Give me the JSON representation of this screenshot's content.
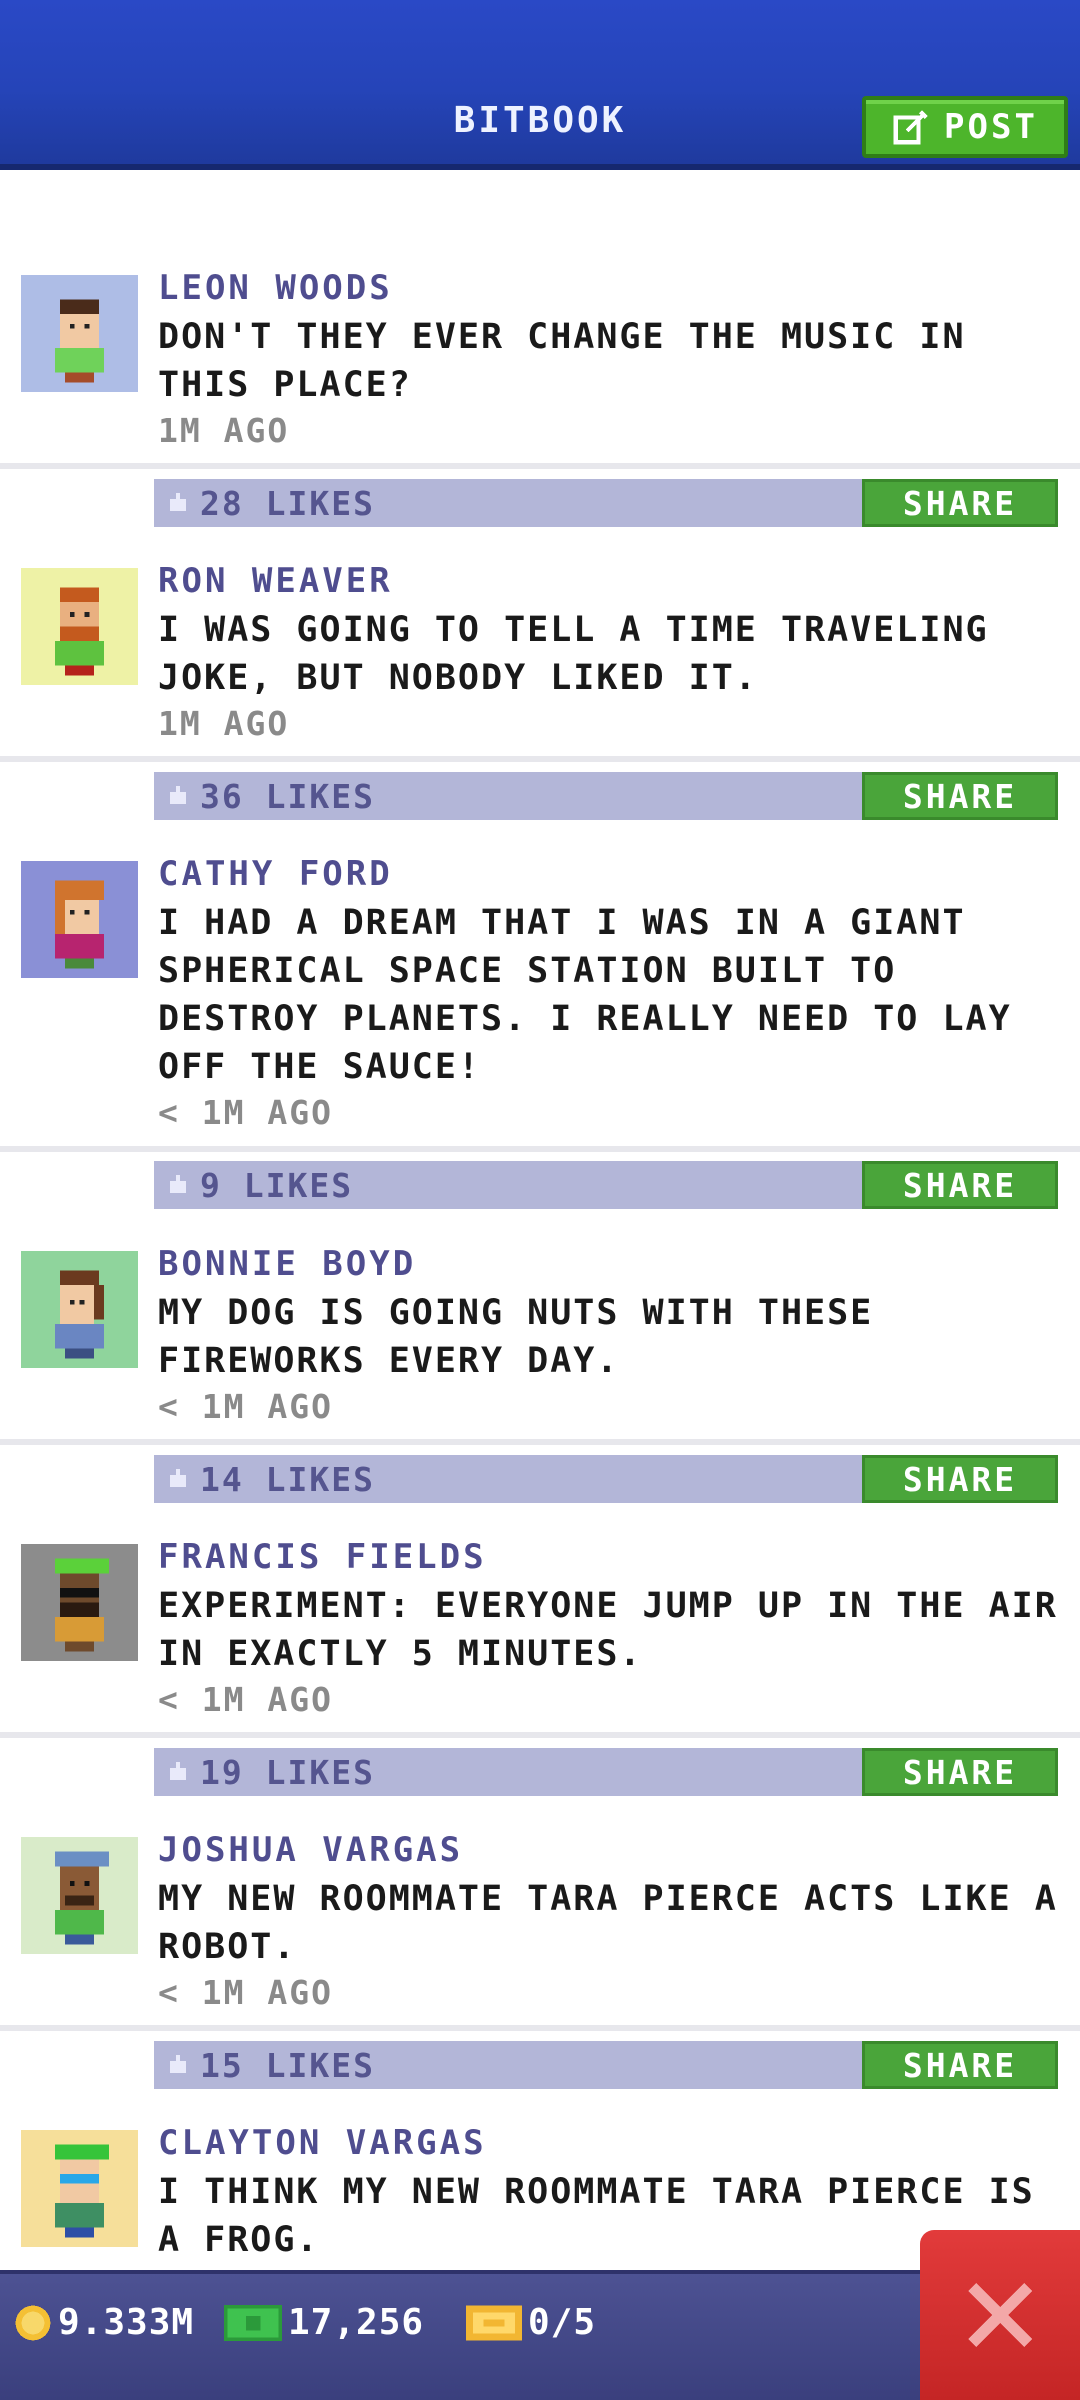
{
  "header": {
    "title": "BITBOOK",
    "post_label": "POST"
  },
  "colors": {
    "header": "#2544b8",
    "accent_green": "#4db52b",
    "likes_bar": "#b3b6d8",
    "name_text": "#4f4d8f",
    "close_red": "#d22f2f"
  },
  "posts": [
    {
      "name": "LEON WOODS",
      "message": "DON'T THEY EVER CHANGE THE MUSIC IN THIS PLACE?",
      "time": "1M AGO",
      "likes": "28 LIKES",
      "share": "SHARE",
      "avatar_bg": "#aebde6"
    },
    {
      "name": "RON WEAVER",
      "message": "I WAS GOING TO TELL A TIME TRAVELING JOKE, BUT NOBODY LIKED IT.",
      "time": "1M AGO",
      "likes": "36 LIKES",
      "share": "SHARE",
      "avatar_bg": "#eef2a6"
    },
    {
      "name": "CATHY FORD",
      "message": "I HAD A DREAM THAT I WAS IN A GIANT SPHERICAL SPACE STATION BUILT TO DESTROY PLANETS. I REALLY NEED TO LAY OFF THE SAUCE!",
      "time": "< 1M AGO",
      "likes": "9 LIKES",
      "share": "SHARE",
      "avatar_bg": "#8a90d6"
    },
    {
      "name": "BONNIE BOYD",
      "message": "MY DOG IS GOING NUTS WITH THESE FIREWORKS EVERY DAY.",
      "time": "< 1M AGO",
      "likes": "14 LIKES",
      "share": "SHARE",
      "avatar_bg": "#8fd49c"
    },
    {
      "name": "FRANCIS FIELDS",
      "message": "EXPERIMENT: EVERYONE JUMP UP IN THE AIR IN EXACTLY 5 MINUTES.",
      "time": "< 1M AGO",
      "likes": "19 LIKES",
      "share": "SHARE",
      "avatar_bg": "#8c8c8c"
    },
    {
      "name": "JOSHUA VARGAS",
      "message": "MY NEW ROOMMATE TARA PIERCE ACTS LIKE A ROBOT.",
      "time": "< 1M AGO",
      "likes": "15 LIKES",
      "share": "SHARE",
      "avatar_bg": "#d9ebc9"
    },
    {
      "name": "CLAYTON VARGAS",
      "message": "I THINK MY NEW ROOMMATE TARA PIERCE IS A FROG.",
      "time": "",
      "likes": "",
      "share": "",
      "avatar_bg": "#f6df9a"
    }
  ],
  "bottom_bar": {
    "coins": "9.333M",
    "bux": "17,256",
    "tickets": "0/5"
  }
}
